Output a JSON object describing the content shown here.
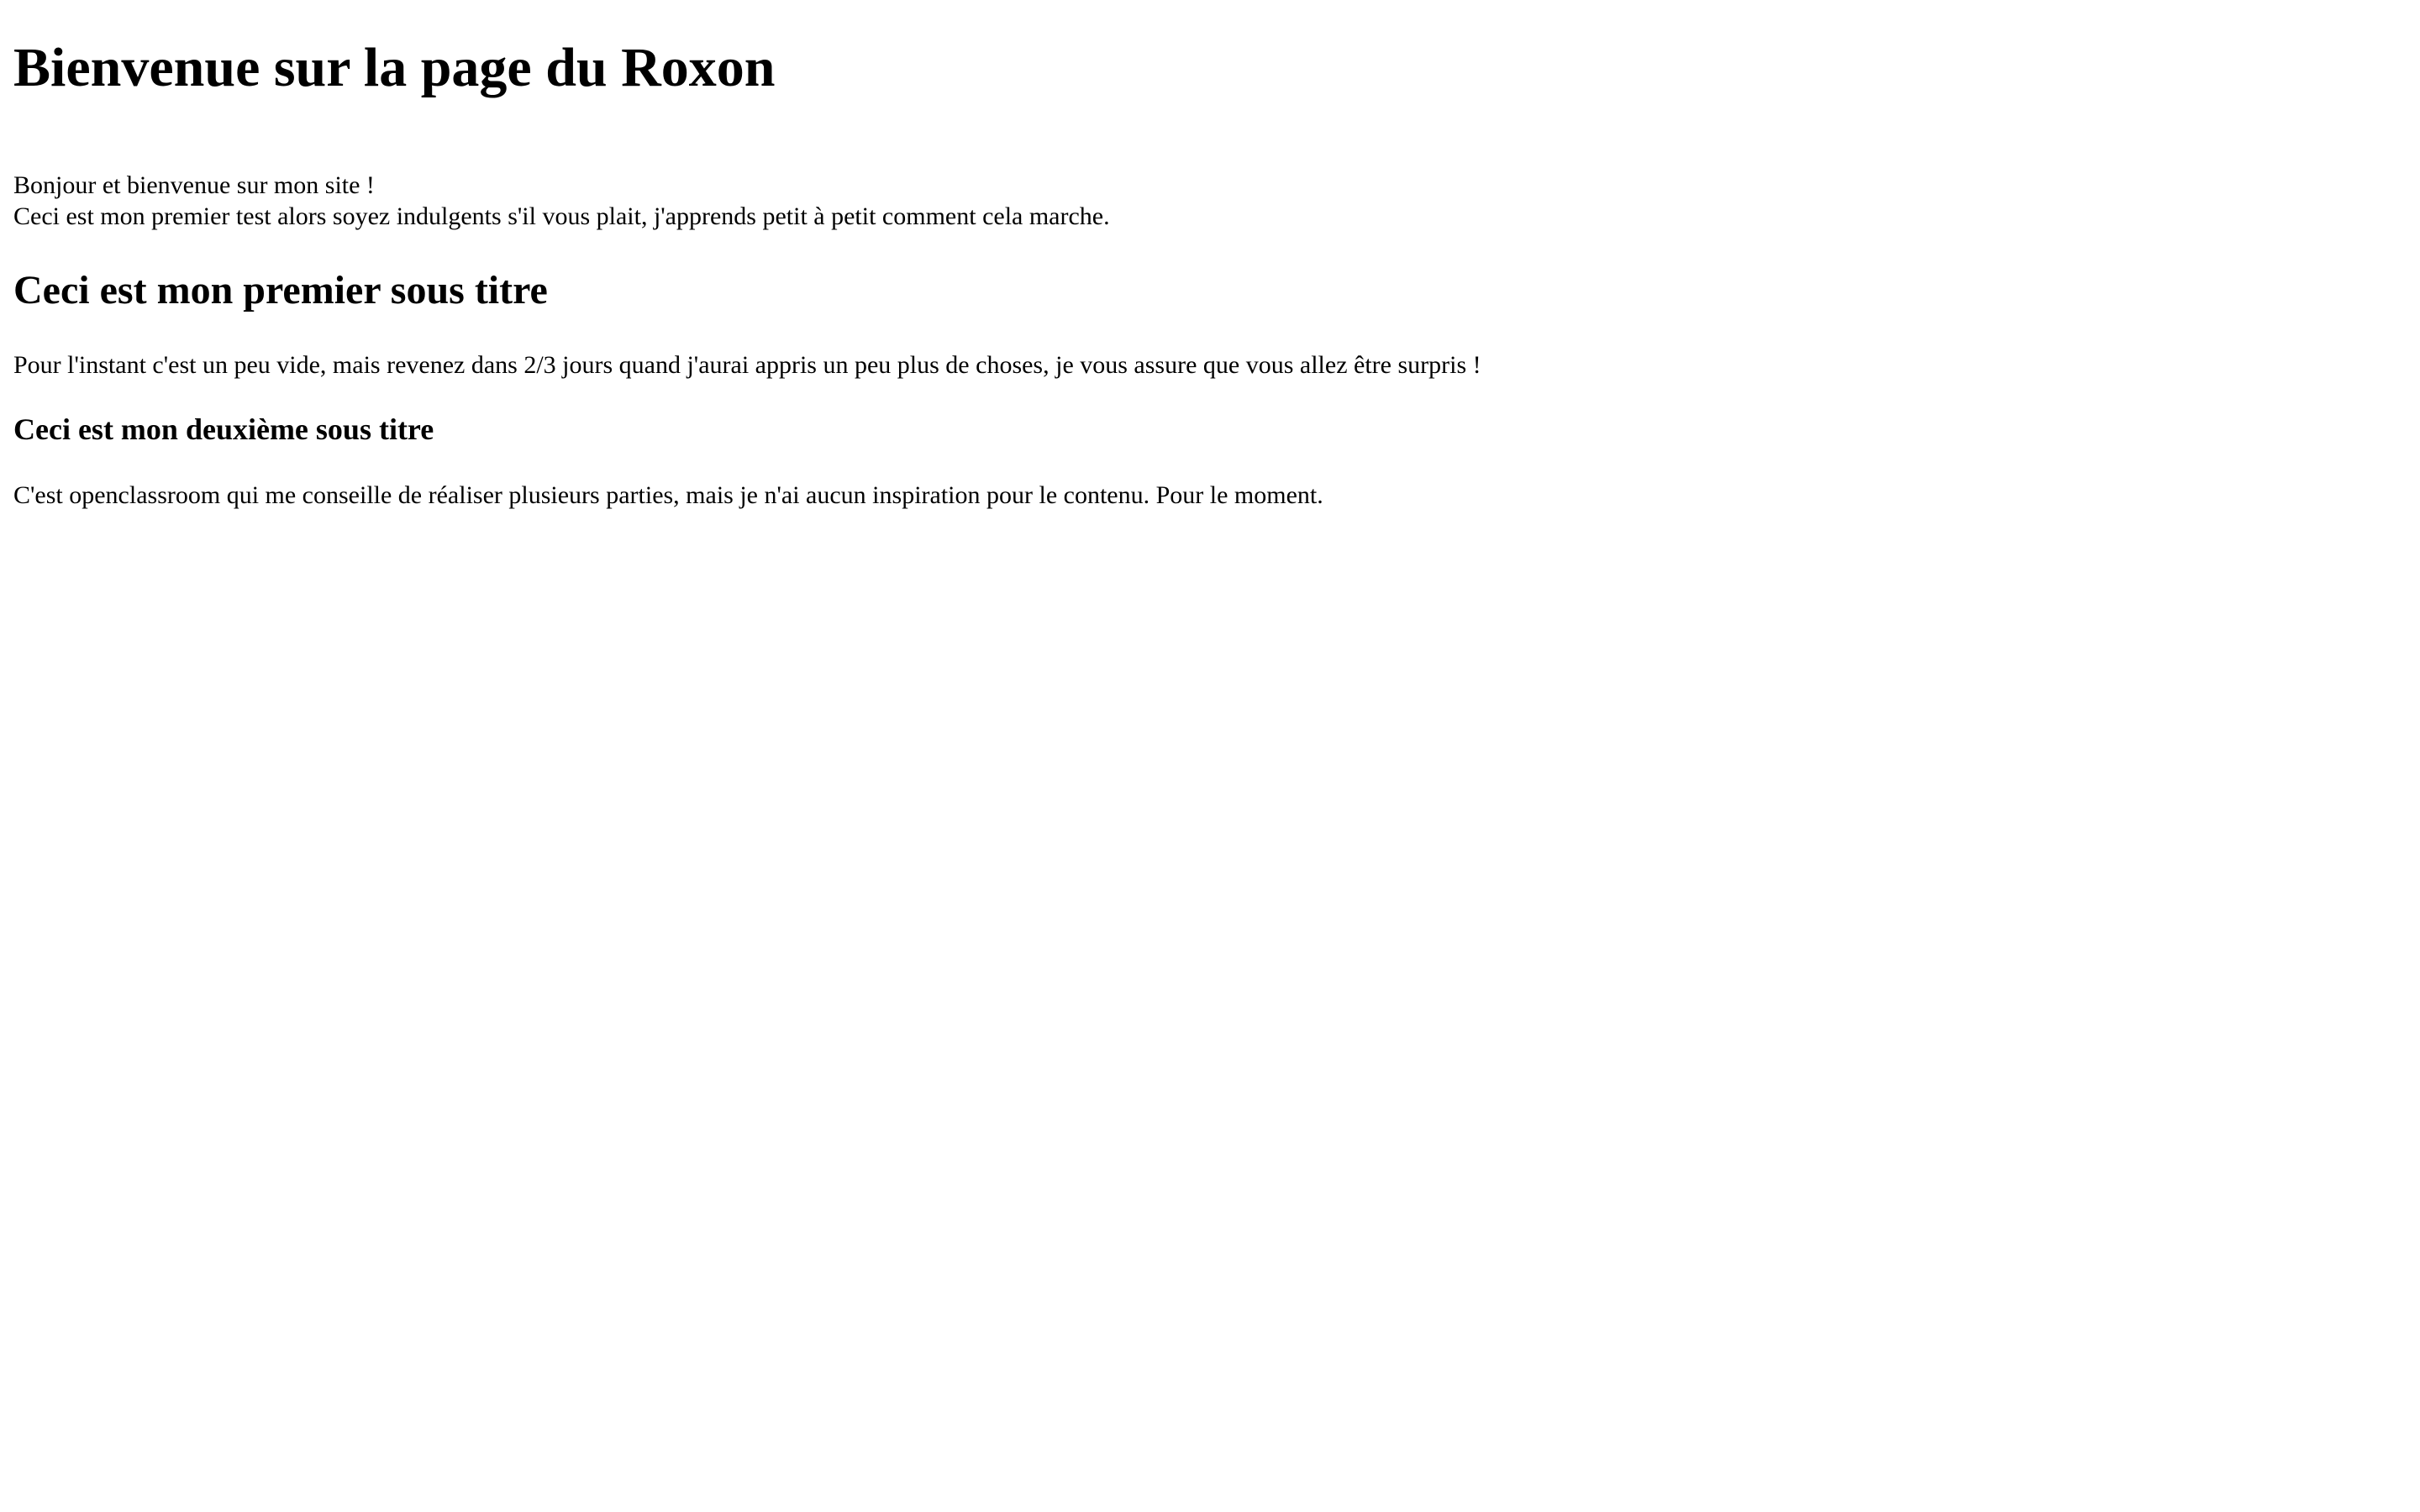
{
  "page": {
    "title": "Bienvenue sur la page du Roxon",
    "intro_line_1": "Bonjour et bienvenue sur mon site !",
    "intro_line_2": "Ceci est mon premier test alors soyez indulgents s'il vous plait, j'apprends petit à petit comment cela marche.",
    "section1_heading": "Ceci est mon premier sous titre",
    "section1_text": "Pour l'instant c'est un peu vide, mais revenez dans 2/3 jours quand j'aurai appris un peu plus de choses, je vous assure que vous allez être surpris !",
    "section2_heading": "Ceci est mon deuxième sous titre",
    "section2_text": "C'est openclassroom qui me conseille de réaliser plusieurs parties, mais je n'ai aucun inspiration pour le contenu. Pour le moment."
  }
}
